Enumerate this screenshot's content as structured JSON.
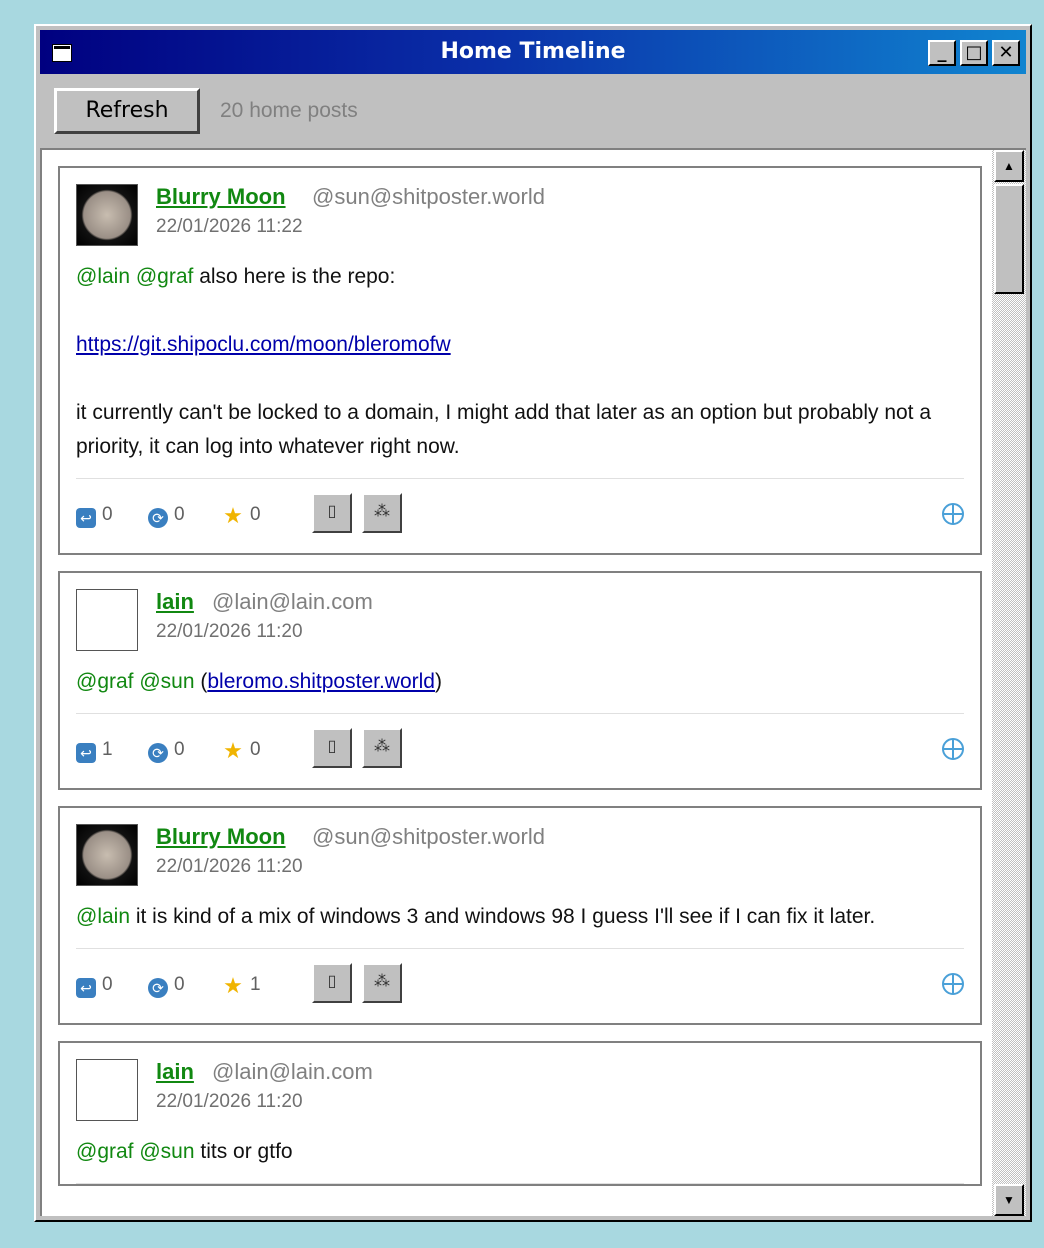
{
  "window": {
    "title": "Home Timeline",
    "buttons": [
      "_",
      "□",
      "✕"
    ]
  },
  "toolbar": {
    "refresh_label": "Refresh",
    "post_count": "20 home posts"
  },
  "posts": [
    {
      "name": "Blurry Moon",
      "handle": "@sun@shitposter.world",
      "date": "22/01/2026 11:22",
      "avatar": "moon",
      "mention1": "@lain",
      "mention2": "@graf",
      "text1": " also here is the repo:",
      "link": "https://git.shipoclu.com/moon/bleromofw",
      "text2": "it currently can't be locked to a domain, I might add that later as an option but probably not a priority, it can log into whatever right now.",
      "replies": "0",
      "boosts": "0",
      "favs": "0"
    },
    {
      "name": "lain",
      "handle": "@lain@lain.com",
      "date": "22/01/2026 11:20",
      "avatar": "lain",
      "mention1": "@graf",
      "mention2": "@sun",
      "paren_open": " (",
      "link": "bleromo.shitposter.world",
      "paren_close": ")",
      "replies": "1",
      "boosts": "0",
      "favs": "0"
    },
    {
      "name": "Blurry Moon",
      "handle": "@sun@shitposter.world",
      "date": "22/01/2026 11:20",
      "avatar": "moon",
      "mention1": "@lain",
      "text1": " it is kind of a mix of windows 3 and windows 98 I guess I'll see if I can fix it later.",
      "replies": "0",
      "boosts": "0",
      "favs": "1"
    },
    {
      "name": "lain",
      "handle": "@lain@lain.com",
      "date": "22/01/2026 11:20",
      "avatar": "lain",
      "mention1": "@graf",
      "mention2": "@sun",
      "text1": " tits or gtfo"
    }
  ],
  "icons": {
    "reply": "reply-icon",
    "boost": "boost-icon",
    "fav": "star-icon",
    "visibility": "globe-icon"
  },
  "colors": {
    "titlebar_start": "#000080",
    "titlebar_end": "#1084d0",
    "mention": "#118811",
    "link": "#0000aa",
    "background": "#a8d8e0"
  }
}
